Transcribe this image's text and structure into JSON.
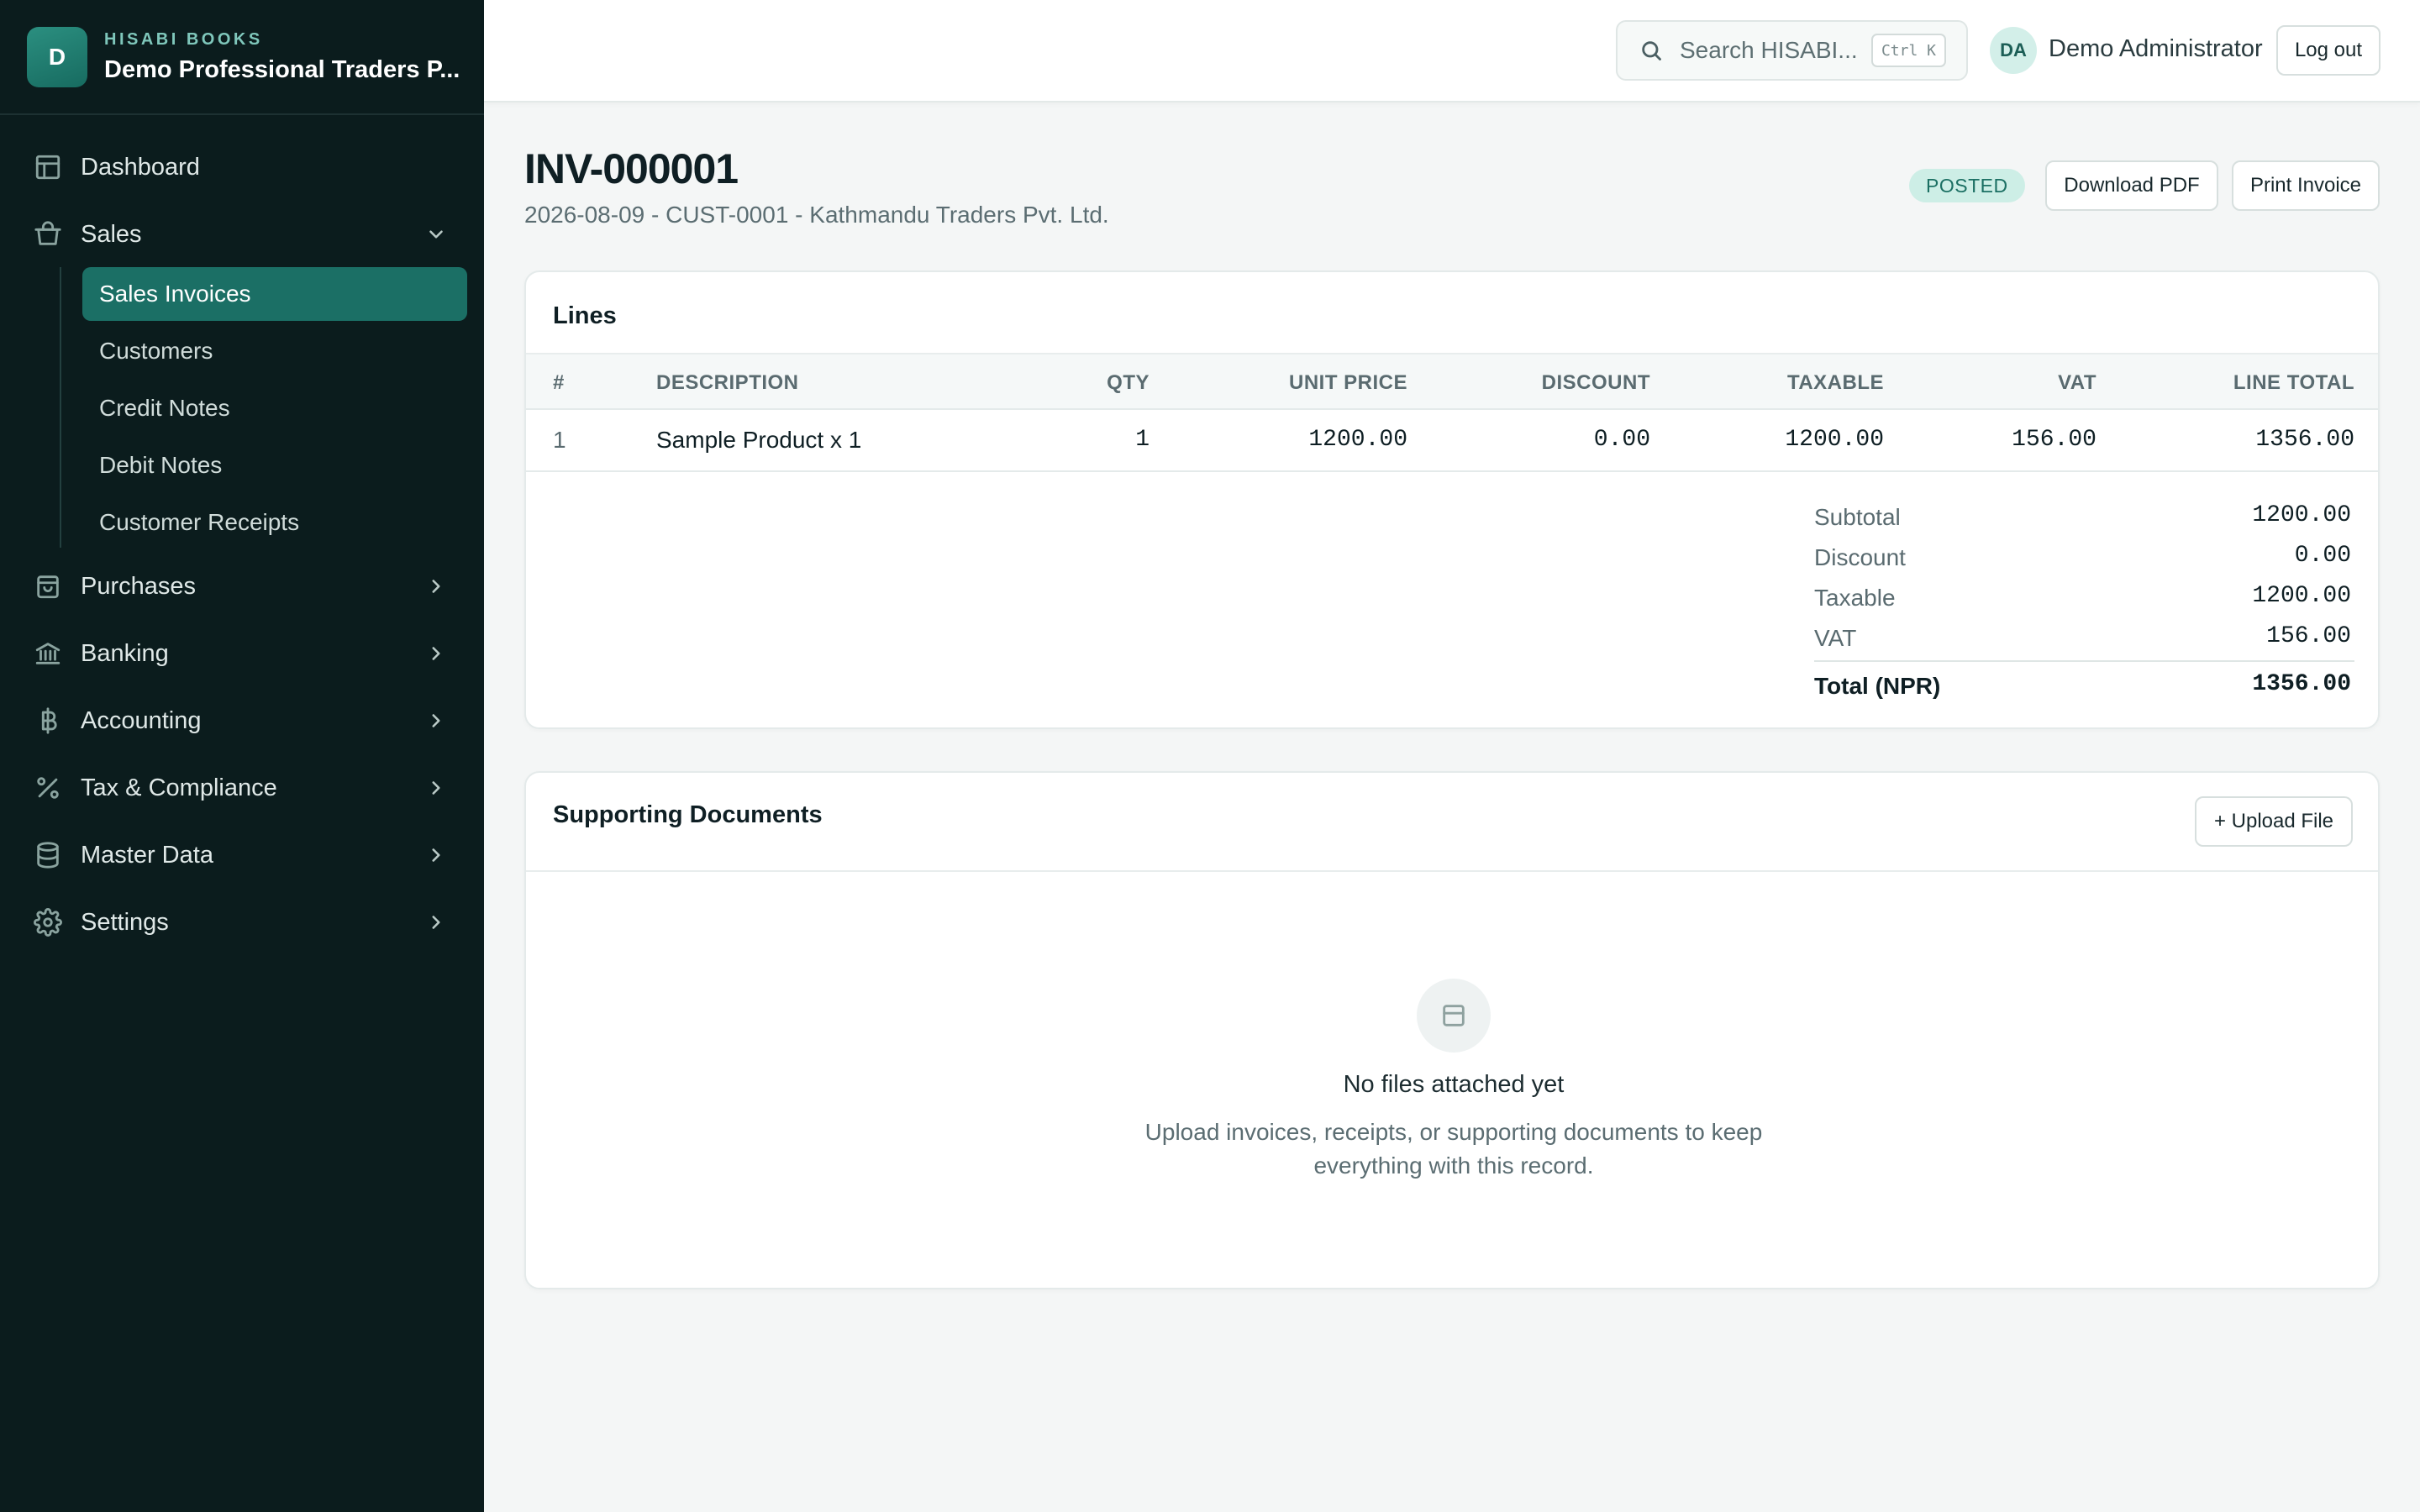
{
  "brand": {
    "logo_letter": "D",
    "app_name": "HISABI BOOKS",
    "company": "Demo Professional Traders P..."
  },
  "nav": {
    "dashboard": "Dashboard",
    "sales": "Sales",
    "sales_sub": [
      "Sales Invoices",
      "Customers",
      "Credit Notes",
      "Debit Notes",
      "Customer Receipts"
    ],
    "purchases": "Purchases",
    "banking": "Banking",
    "accounting": "Accounting",
    "tax": "Tax & Compliance",
    "master_data": "Master Data",
    "settings": "Settings"
  },
  "topbar": {
    "search_placeholder": "Search HISABI...",
    "search_shortcut": "Ctrl K",
    "avatar_initials": "DA",
    "user_name": "Demo Administrator",
    "logout_label": "Log out"
  },
  "invoice": {
    "number": "INV-000001",
    "meta": "2026-08-09 - CUST-0001 - Kathmandu Traders Pvt. Ltd.",
    "status": "POSTED",
    "download_label": "Download PDF",
    "print_label": "Print Invoice"
  },
  "lines": {
    "title": "Lines",
    "columns": [
      "#",
      "DESCRIPTION",
      "QTY",
      "UNIT PRICE",
      "DISCOUNT",
      "TAXABLE",
      "VAT",
      "LINE TOTAL"
    ],
    "rows": [
      [
        "1",
        "Sample Product x 1",
        "1",
        "1200.00",
        "0.00",
        "1200.00",
        "156.00",
        "1356.00"
      ]
    ],
    "totals": [
      {
        "label": "Subtotal",
        "value": "1200.00"
      },
      {
        "label": "Discount",
        "value": "0.00"
      },
      {
        "label": "Taxable",
        "value": "1200.00"
      },
      {
        "label": "VAT",
        "value": "156.00"
      }
    ],
    "grand_total_label": "Total (NPR)",
    "grand_total_value": "1356.00"
  },
  "documents": {
    "title": "Supporting Documents",
    "upload_label": "+ Upload File",
    "empty_title": "No files attached yet",
    "empty_desc": "Upload invoices, receipts, or supporting documents to keep everything with this record."
  },
  "colors": {
    "sidebar_bg": "#0b1c1d",
    "accent": "#1b6f65",
    "badge_bg": "#cdeee6"
  },
  "icons": [
    "dashboard-icon",
    "shopping-bag-icon",
    "purchases-icon",
    "bank-icon",
    "baht-icon",
    "percent-icon",
    "database-icon",
    "gear-icon",
    "chevron-down-icon",
    "chevron-right-icon",
    "search-icon",
    "document-icon"
  ]
}
